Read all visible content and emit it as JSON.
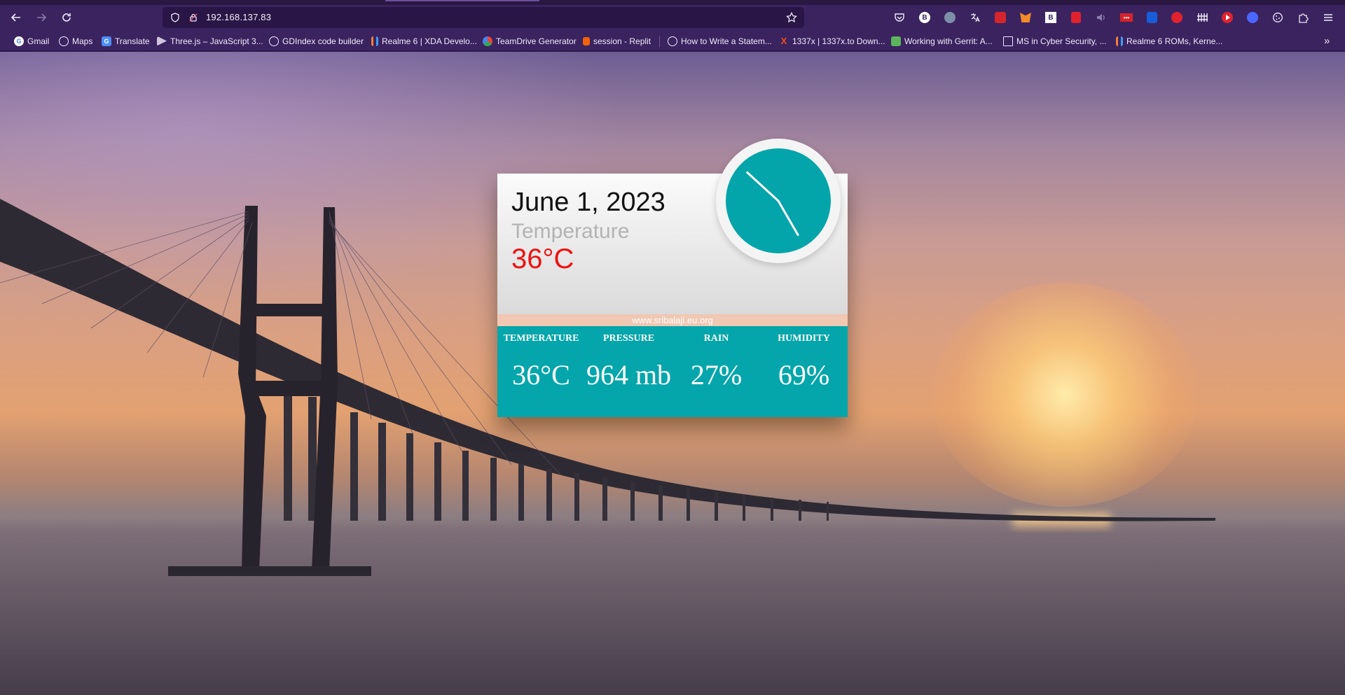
{
  "browser": {
    "url": "192.168.137.83",
    "bookmarks": [
      {
        "label": "Gmail",
        "icon": "google-icon"
      },
      {
        "label": "Maps",
        "icon": "globe-icon"
      },
      {
        "label": "Translate",
        "icon": "translate-icon"
      },
      {
        "label": "Three.js – JavaScript 3...",
        "icon": "threejs-icon"
      },
      {
        "label": "GDIndex code builder",
        "icon": "globe-icon"
      },
      {
        "label": "Realme 6 | XDA Develo...",
        "icon": "xda-icon"
      },
      {
        "label": "TeamDrive Generator",
        "icon": "teamdrive-icon"
      },
      {
        "label": "session - Replit",
        "icon": "replit-icon"
      },
      {
        "label": "How to Write a Statem...",
        "icon": "globe-icon"
      },
      {
        "label": "1337x | 1337x.to Down...",
        "icon": "1337x-icon"
      },
      {
        "label": "Working with Gerrit: A...",
        "icon": "gerrit-icon"
      },
      {
        "label": "MS in Cyber Security, ...",
        "icon": "university-icon"
      },
      {
        "label": "Realme 6 ROMs, Kerne...",
        "icon": "xda-icon"
      }
    ],
    "extension_labels": {
      "b_badge": "B",
      "box_badge": "B",
      "dots": "•••"
    }
  },
  "widget": {
    "date": "June 1, 2023",
    "temperature_label": "Temperature",
    "temperature_value": "36°C",
    "site": "www.sribalaji.eu.org",
    "clock_time": "10:25",
    "stats": [
      {
        "label": "TEMPERATURE",
        "value": "36°C"
      },
      {
        "label": "PRESSURE",
        "value": "964 mb"
      },
      {
        "label": "RAIN",
        "value": "27%"
      },
      {
        "label": "HUMIDITY",
        "value": "69%"
      }
    ]
  },
  "colors": {
    "chrome": "#3b2360",
    "widget_teal": "#05a6ab",
    "temp_red": "#ee1111",
    "site_bar": "#f1c8b2"
  }
}
